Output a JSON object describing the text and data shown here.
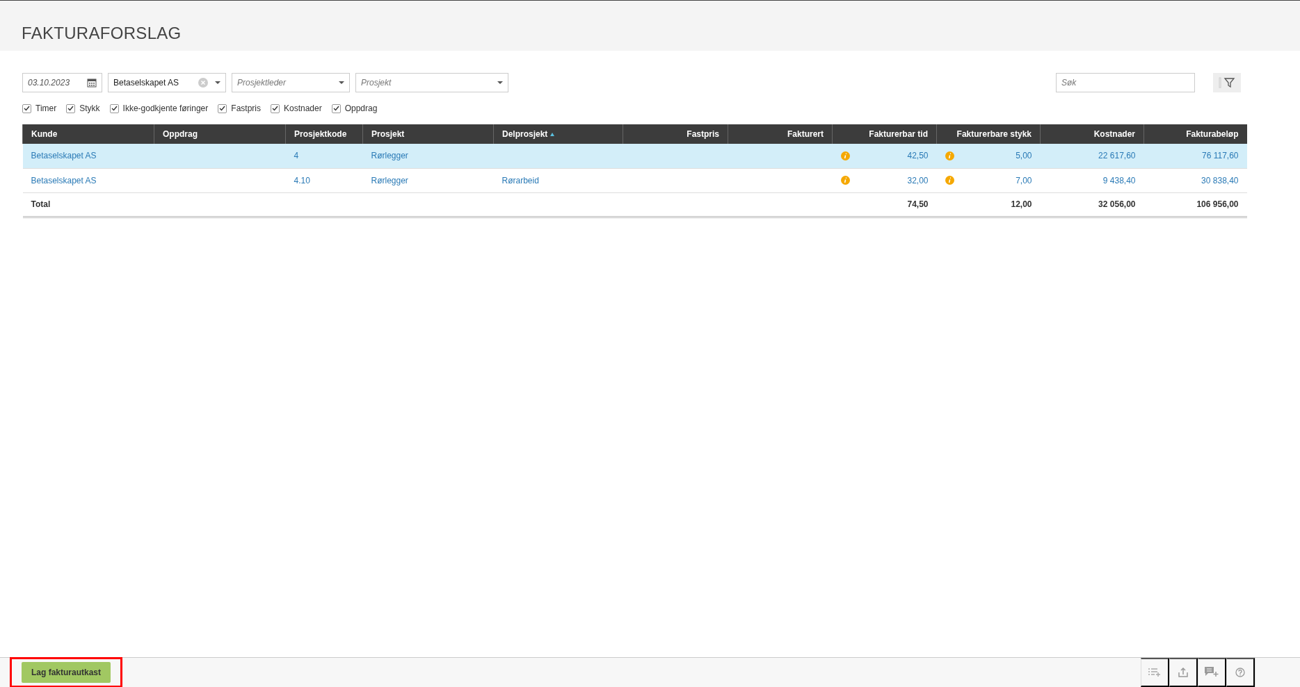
{
  "page": {
    "title": "FAKTURAFORSLAG"
  },
  "filters": {
    "date": {
      "value": "03.10.2023"
    },
    "customer": {
      "value": "Betaselskapet AS"
    },
    "project_leader": {
      "placeholder": "Prosjektleder"
    },
    "project": {
      "placeholder": "Prosjekt"
    },
    "search": {
      "placeholder": "Søk"
    }
  },
  "checkboxes": [
    {
      "label": "Timer",
      "checked": true
    },
    {
      "label": "Stykk",
      "checked": true
    },
    {
      "label": "Ikke-godkjente føringer",
      "checked": true
    },
    {
      "label": "Fastpris",
      "checked": true
    },
    {
      "label": "Kostnader",
      "checked": true
    },
    {
      "label": "Oppdrag",
      "checked": true
    }
  ],
  "table": {
    "columns": [
      {
        "label": "Kunde",
        "sorted": false
      },
      {
        "label": "Oppdrag",
        "sorted": false
      },
      {
        "label": "Prosjektkode",
        "sorted": false
      },
      {
        "label": "Prosjekt",
        "sorted": false
      },
      {
        "label": "Delprosjekt",
        "sorted": true
      },
      {
        "label": "Fastpris",
        "sorted": false
      },
      {
        "label": "Fakturert",
        "sorted": false
      },
      {
        "label": "Fakturerbar tid",
        "sorted": false
      },
      {
        "label": "Fakturerbare stykk",
        "sorted": false
      },
      {
        "label": "Kostnader",
        "sorted": false
      },
      {
        "label": "Fakturabeløp",
        "sorted": false
      }
    ],
    "rows": [
      {
        "selected": true,
        "cells": [
          "Betaselskapet AS",
          null,
          "4",
          "Rørlegger",
          null,
          null,
          null,
          {
            "text": "42,50",
            "info": true
          },
          {
            "text": "5,00",
            "info": true
          },
          "22 617,60",
          "76 117,60"
        ]
      },
      {
        "selected": false,
        "cells": [
          "Betaselskapet AS",
          null,
          "4.10",
          "Rørlegger",
          "Rørarbeid",
          null,
          null,
          {
            "text": "32,00",
            "info": true
          },
          {
            "text": "7,00",
            "info": true
          },
          "9 438,40",
          "30 838,40"
        ]
      }
    ],
    "total": {
      "label": "Total",
      "cells": [
        null,
        null,
        null,
        null,
        null,
        null,
        "74,50",
        "12,00",
        "32 056,00",
        "106 956,00"
      ]
    }
  },
  "footer": {
    "button": {
      "label": "Lag fakturautkast",
      "highlighted": true
    }
  }
}
